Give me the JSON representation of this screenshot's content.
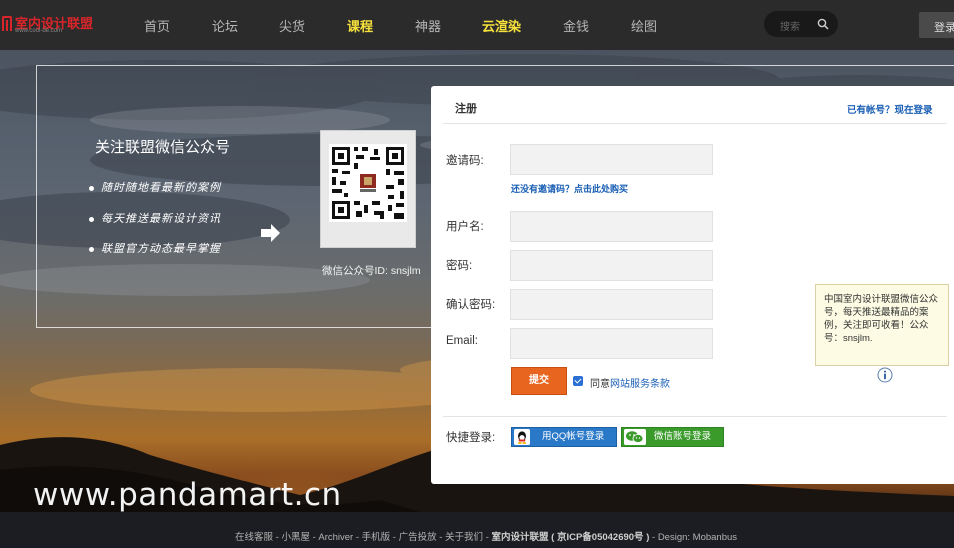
{
  "brand": {
    "name": "室内设计联盟",
    "url": "www.cool-de.com"
  },
  "nav": {
    "items": [
      {
        "label": "首页",
        "highlight": false
      },
      {
        "label": "论坛",
        "highlight": false
      },
      {
        "label": "尖货",
        "highlight": false
      },
      {
        "label": "课程",
        "highlight": true
      },
      {
        "label": "神器",
        "highlight": false
      },
      {
        "label": "云渲染",
        "highlight": true
      },
      {
        "label": "金钱",
        "highlight": false
      },
      {
        "label": "绘图",
        "highlight": false
      }
    ],
    "search_placeholder": "搜索",
    "login_label": "登录",
    "highlight_color": "#f7e13b"
  },
  "wechat": {
    "title": "关注联盟微信公众号",
    "bullets": [
      "随时随地看最新的案例",
      "每天推送最新设计资讯",
      "联盟官方动态最早掌握"
    ],
    "qr_caption": "微信公众号ID: snsjlm"
  },
  "register": {
    "title": "注册",
    "have_account_link": "已有帐号？现在登录",
    "fields": [
      {
        "label": "邀请码:",
        "value": ""
      },
      {
        "label": "用户名:",
        "value": ""
      },
      {
        "label": "密码:",
        "value": ""
      },
      {
        "label": "确认密码:",
        "value": ""
      },
      {
        "label": "Email:",
        "value": ""
      }
    ],
    "invite_link": "还没有邀请码？点击此处购买",
    "submit_label": "提交",
    "agree_prefix": "同意",
    "agree_link": "网站服务条款",
    "agree_checked": true,
    "quick_login_label": "快捷登录:",
    "qq_login_label": "用QQ帐号登录",
    "wechat_login_label": "微信账号登录",
    "accent_color": "#e8651f",
    "link_color": "#1a5fb4"
  },
  "tip": {
    "text": "中国室内设计联盟微信公众号，每天推送最精品的案例，关注即可收看！公众号：snsjlm."
  },
  "watermark": "www.pandamart.cn",
  "footer": {
    "links": "在线客服 - 小黑屋 - Archiver - 手机版 - 广告投放 - 关于我们 - ",
    "brand": "室内设计联盟",
    "icp": " ( 京ICP备05042690号 ) ",
    "design": "- Design: Mobanbus"
  }
}
